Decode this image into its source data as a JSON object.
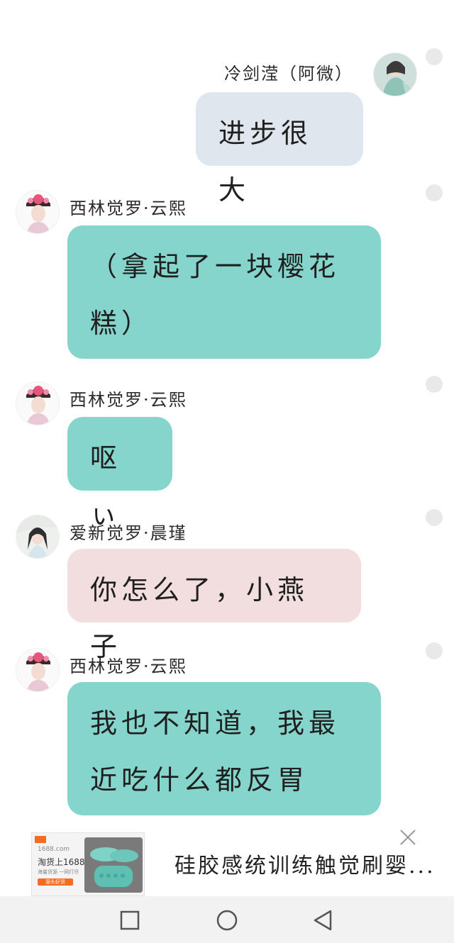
{
  "messages": [
    {
      "sender": "冷剑滢（阿微）",
      "text": "进步很大",
      "side": "right",
      "bubble_color": "#dfe6ee"
    },
    {
      "sender": "西林觉罗·云熙",
      "text": "（拿起了一块樱花糕）",
      "side": "left",
      "bubble_color": "#86d5cd"
    },
    {
      "sender": "西林觉罗·云熙",
      "text": "呕ぃ",
      "side": "left",
      "bubble_color": "#86d5cd"
    },
    {
      "sender": "爱新觉罗·晨瑾",
      "text": "你怎么了，小燕子",
      "side": "left",
      "bubble_color": "#f2dedf"
    },
    {
      "sender": "西林觉罗·云熙",
      "text": "我也不知道，我最近吃什么都反胃",
      "side": "left",
      "bubble_color": "#86d5cd"
    }
  ],
  "ad": {
    "site": "1688.com",
    "headline": "淘货上1688",
    "subline": "海量货源 一网打尽",
    "button": "源头好货",
    "title": "硅胶感统训练触觉刷婴..."
  },
  "navbar": {
    "icons": [
      "recent-apps-icon",
      "home-icon",
      "back-icon"
    ]
  }
}
